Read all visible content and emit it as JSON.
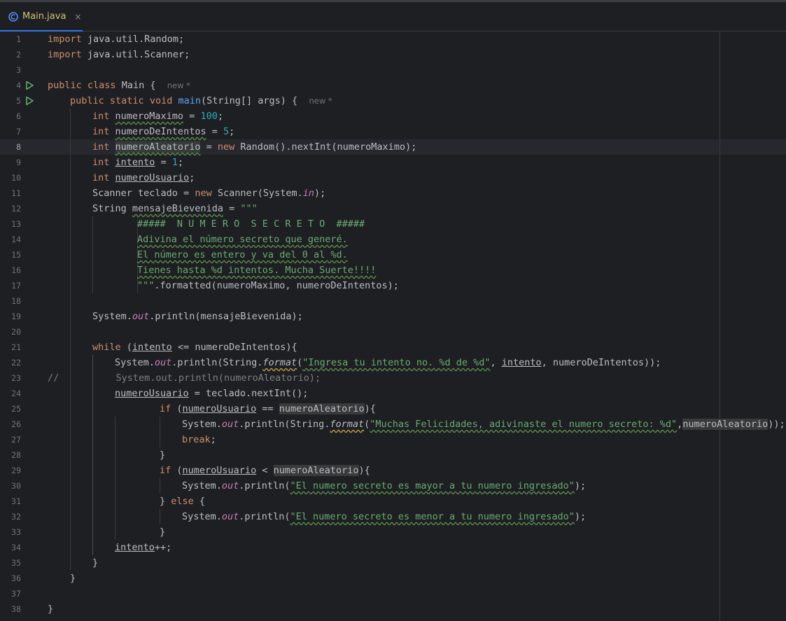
{
  "tab": {
    "file_name": "Main.java",
    "close": "×",
    "icon": "java-class-icon"
  },
  "editor": {
    "current_line": 8,
    "gutter_run_icon_lines": [
      4,
      5
    ],
    "line_numbers": [
      "1",
      "2",
      "3",
      "4",
      "5",
      "6",
      "7",
      "8",
      "9",
      "10",
      "11",
      "12",
      "13",
      "14",
      "15",
      "16",
      "17",
      "18",
      "19",
      "20",
      "21",
      "22",
      "23",
      "24",
      "25",
      "26",
      "27",
      "28",
      "29",
      "30",
      "31",
      "32",
      "33",
      "34",
      "35",
      "36",
      "37",
      "38"
    ],
    "code": {
      "l1": {
        "kw": "import",
        "rest": " java.util.Random;"
      },
      "l2": {
        "kw": "import",
        "rest": " java.util.Scanner;"
      },
      "l4": {
        "kw1": "public",
        "kw2": "class",
        "name": " Main {",
        "hint": "new *"
      },
      "l5": {
        "kw1": "public",
        "kw2": "static",
        "kw3": "void",
        "fn": "main",
        "rest": "(String[] args) {",
        "hint": "new *"
      },
      "l6": {
        "kw": "int",
        "var": "numeroMaximo",
        "op": " = ",
        "num": "100",
        "end": ";"
      },
      "l7": {
        "kw": "int",
        "var": "numeroDeIntentos",
        "op": " = ",
        "num": "5",
        "end": ";"
      },
      "l8": {
        "kw": "int",
        "var": "numeroAleatorio",
        "op": " = ",
        "kw2": "new",
        "rest": " Random().nextInt(numeroMaximo);"
      },
      "l9": {
        "kw": "int",
        "var": "intento",
        "op": " = ",
        "num": "1",
        "end": ";"
      },
      "l10": {
        "kw": "int",
        "var": "numeroUsuario",
        "end": ";"
      },
      "l11": {
        "t1": "Scanner ",
        "var": "teclado",
        "op": " = ",
        "kw": "new",
        "t2": " Scanner(System.",
        "st": "in",
        "t3": ");"
      },
      "l12": {
        "t1": "String ",
        "var": "mensajeBievenida",
        "op": " = ",
        "str": "\"\"\""
      },
      "l13": {
        "str": "#####  N U M E R O  S E C R E T O  #####"
      },
      "l14": {
        "str": "Adivina el número secreto que generé."
      },
      "l15": {
        "str": "El número es entero y va del 0 al %d."
      },
      "l16": {
        "str": "Tienes hasta %d intentos. Mucha Suerte!!!!"
      },
      "l17": {
        "str": "\"\"\"",
        "rest": ".formatted(numeroMaximo, numeroDeIntentos);"
      },
      "l19": {
        "t1": "System.",
        "st": "out",
        "t2": ".println(mensajeBievenida);"
      },
      "l21": {
        "kw": "while",
        "t1": " (",
        "var": "intento",
        "t2": " <= numeroDeIntentos){"
      },
      "l22": {
        "t1": "System.",
        "st": "out",
        "t2": ".println(String.",
        "fmt": "format",
        "t3": "(",
        "str": "\"Ingresa tu intento no. %d de %d\"",
        "t4": ", ",
        "var": "intento",
        "t5": ", numeroDeIntentos));"
      },
      "l23": {
        "cmt": "//          System.out.println(numeroAleatorio);"
      },
      "l24": {
        "var": "numeroUsuario",
        "t1": " = teclado.nextInt();"
      },
      "l25": {
        "kw": "if",
        "t1": " (",
        "var": "numeroUsuario",
        "t2": " == ",
        "hl": "numeroAleatorio",
        "t3": "){"
      },
      "l26": {
        "t1": "System.",
        "st": "out",
        "t2": ".println(String.",
        "fmt": "format",
        "t3": "(",
        "str": "\"Muchas Felicidades, adivinaste el numero secreto: %d\"",
        "t4": ",",
        "hl": "numeroAleatorio",
        "t5": "));"
      },
      "l27": {
        "kw": "break",
        "end": ";"
      },
      "l28": {
        "t": "}"
      },
      "l29": {
        "kw": "if",
        "t1": " (",
        "var": "numeroUsuario",
        "t2": " < ",
        "hl": "numeroAleatorio",
        "t3": "){"
      },
      "l30": {
        "t1": "System.",
        "st": "out",
        "t2": ".println(",
        "str": "\"El numero secreto es mayor a tu numero ingresado\"",
        "t3": ");"
      },
      "l31": {
        "t1": "} ",
        "kw": "else",
        "t2": " {"
      },
      "l32": {
        "t1": "System.",
        "st": "out",
        "t2": ".println(",
        "str": "\"El numero secreto es menor a tu numero ingresado\"",
        "t3": ");"
      },
      "l33": {
        "t": "}"
      },
      "l34": {
        "var": "intento",
        "t": "++;"
      },
      "l35": {
        "t": "}"
      },
      "l36": {
        "t": "}"
      },
      "l38": {
        "t": "}"
      }
    }
  }
}
